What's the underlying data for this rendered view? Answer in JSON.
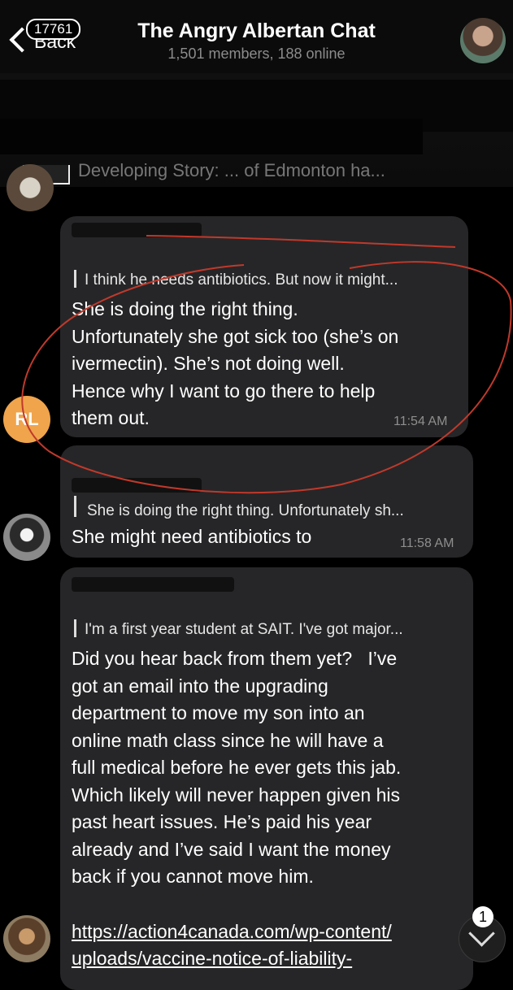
{
  "header": {
    "back_label": "Back",
    "unread_count": "17761",
    "title": "The Angry Albertan Chat",
    "subtitle": "1,501 members, 188 online"
  },
  "pinned": {
    "text": "Developing Story: ... of Edmonton ha..."
  },
  "messages": [
    {
      "reply_preview": "I think he needs antibiotics. But now it might...",
      "text_lines": [
        "She is doing the right thing.",
        "Unfortunately she got sick too (she’s on",
        "ivermectin). She’s not doing well.",
        "Hence why I want to go there to help",
        "them out."
      ],
      "time": "11:54 AM",
      "avatar_initials": "RL"
    },
    {
      "reply_preview": "She is doing the right thing. Unfortunately sh...",
      "text_lines": [
        "She might need antibiotics to"
      ],
      "time": "11:58 AM"
    },
    {
      "reply_preview": "I'm a first year student at SAIT. I've got major...",
      "text_lines": [
        "Did you hear back from them yet?   I’ve",
        "got an email into the upgrading",
        "department to move my son into an",
        "online math class since he will have a",
        "full medical before he ever gets this jab.",
        "Which likely will never happen given his",
        "past heart issues. He’s paid his year",
        "already and I’ve said I want the money",
        "back if you cannot move him."
      ],
      "link_lines": [
        "https://action4canada.com/wp-content/",
        "uploads/vaccine-notice-of-liability-"
      ]
    }
  ],
  "scroll_down": {
    "unread_count": "1"
  },
  "colors": {
    "background": "#000000",
    "bubble": "#262628",
    "annotation_circle": "#c0392b",
    "initials_avatar": "#f0a44b"
  }
}
